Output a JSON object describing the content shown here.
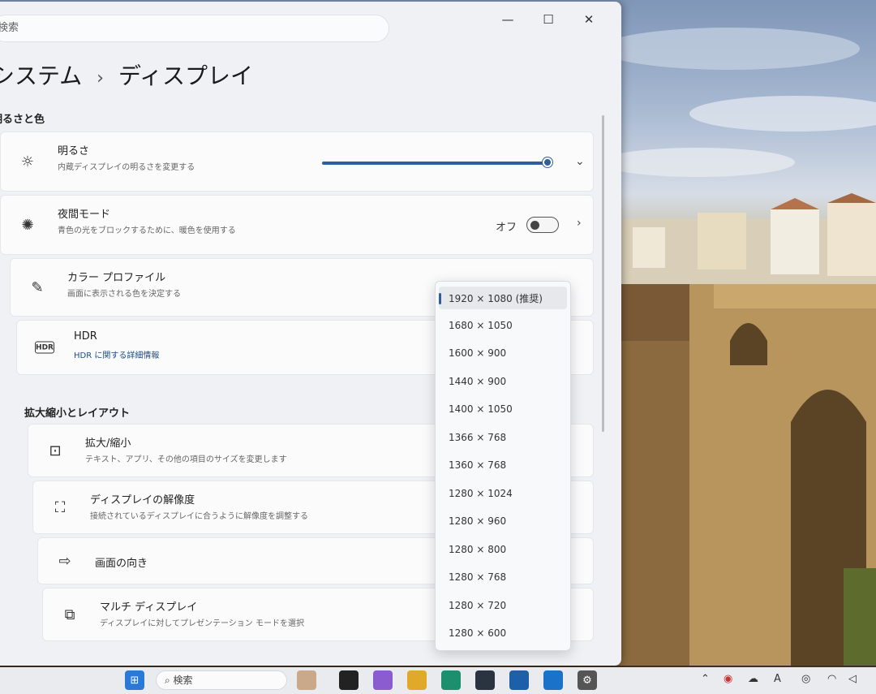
{
  "window": {
    "search_placeholder": "検索",
    "breadcrumb_parent": "システム",
    "breadcrumb_current": "ディスプレイ",
    "controls": {
      "minimize": "—",
      "maximize": "☐",
      "close": "✕"
    }
  },
  "sections": {
    "brightness_color": "明るさと色",
    "scale_layout": "拡大縮小とレイアウト"
  },
  "settings": {
    "brightness": {
      "label": "明るさ",
      "sub": "内蔵ディスプレイの明るさを変更する",
      "level": 1.0
    },
    "night_light": {
      "label": "夜間モード",
      "sub": "青色の光をブロックするために、暖色を使用する",
      "state": "オフ"
    },
    "color_profile": {
      "label": "カラー プロファイル",
      "sub": "画面に表示される色を決定する"
    },
    "hdr": {
      "label": "HDR",
      "sub": "HDR に関する詳細情報"
    },
    "scale": {
      "label": "拡大/縮小",
      "sub": "テキスト、アプリ、その他の項目のサイズを変更します"
    },
    "resolution": {
      "label": "ディスプレイの解像度",
      "sub": "接続されているディスプレイに合うように解像度を調整する"
    },
    "orientation": {
      "label": "画面の向き"
    },
    "multi_display": {
      "label": "マルチ ディスプレイ",
      "sub": "ディスプレイに対してプレゼンテーション モードを選択"
    }
  },
  "resolution_options": [
    "1920 × 1080 (推奨)",
    "1680 × 1050",
    "1600 × 900",
    "1440 × 900",
    "1400 × 1050",
    "1366 × 768",
    "1360 × 768",
    "1280 × 1024",
    "1280 × 960",
    "1280 × 800",
    "1280 × 768",
    "1280 × 720",
    "1280 × 600"
  ],
  "resolution_selected_index": 0,
  "taskbar": {
    "search_label": "検索"
  },
  "colors": {
    "accent": "#2f5f9a",
    "window_bg": "#eff1f4",
    "card_bg": "#fbfbfc"
  },
  "icons": {
    "brightness": "sun-icon",
    "night_light": "moon-sun-icon",
    "color_profile": "pen-icon",
    "hdr": "hdr-icon",
    "scale": "scale-icon",
    "resolution": "resolution-icon",
    "orientation": "rotate-icon",
    "multi_display": "multi-display-icon"
  }
}
